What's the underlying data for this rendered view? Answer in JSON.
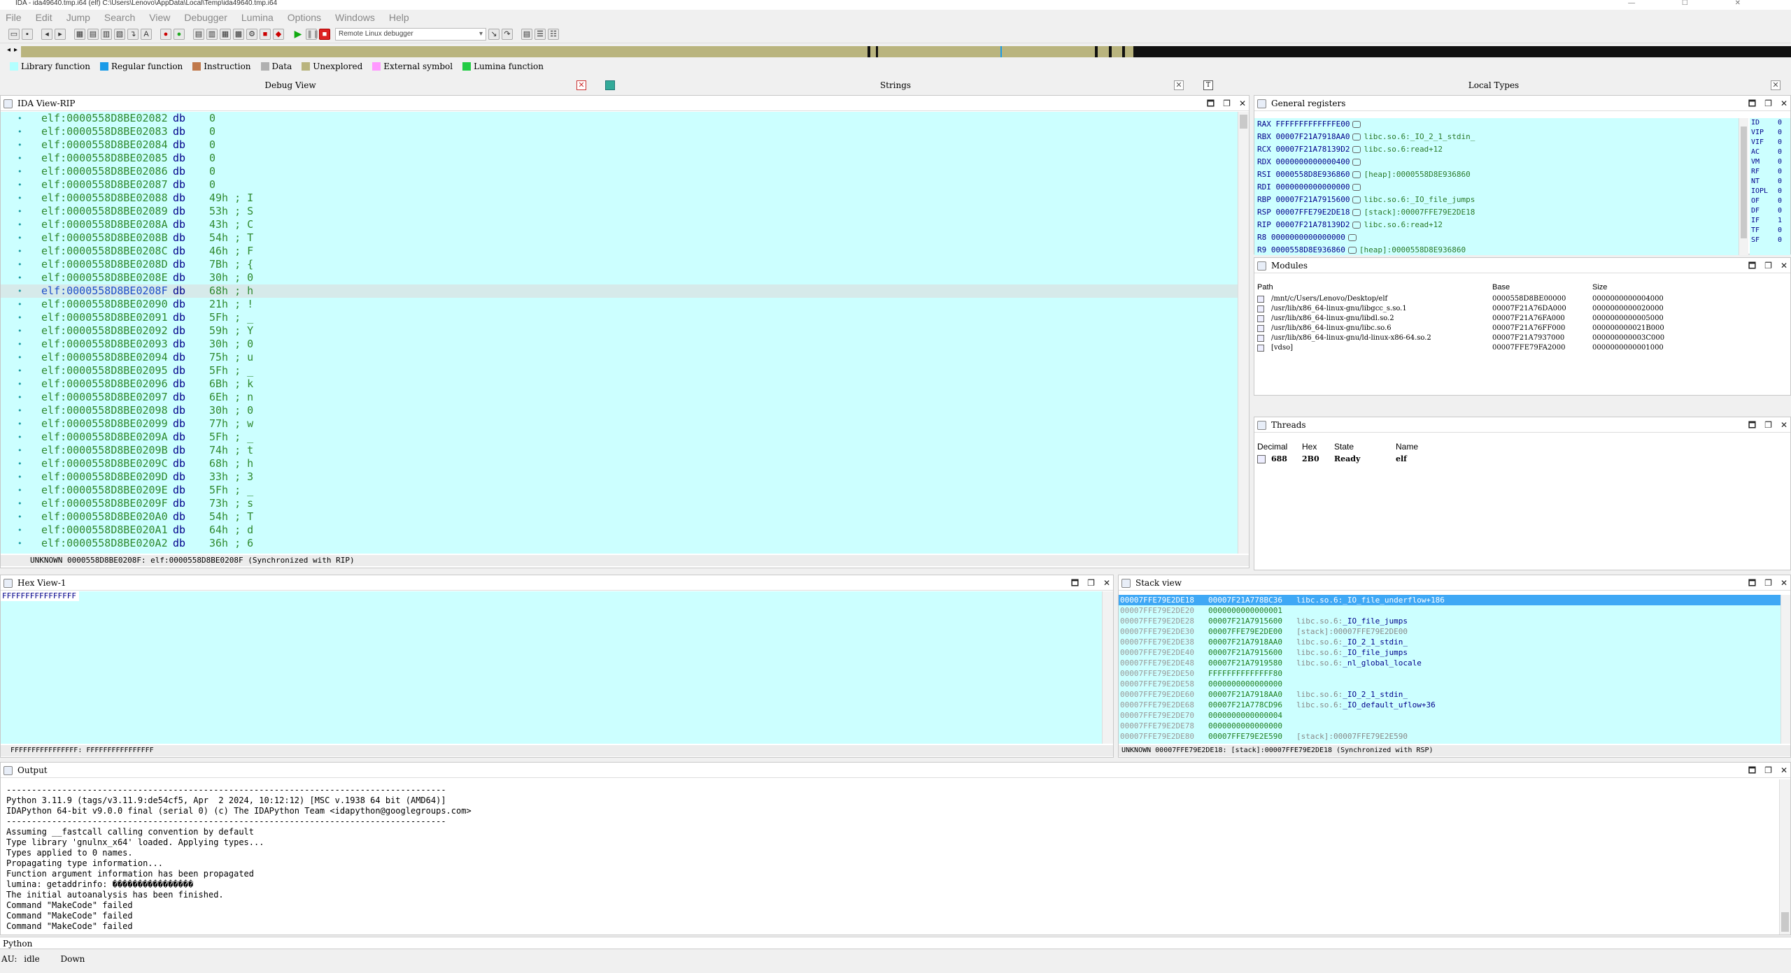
{
  "window": {
    "title": "IDA - ida49640.tmp.i64 (elf) C:\\Users\\Lenovo\\AppData\\Local\\Temp\\ida49640.tmp.i64"
  },
  "menu": [
    "File",
    "Edit",
    "Jump",
    "Search",
    "View",
    "Debugger",
    "Lumina",
    "Options",
    "Windows",
    "Help"
  ],
  "toolbar": {
    "debugger_select": "Remote Linux debugger"
  },
  "legend": [
    {
      "label": "Library function",
      "color": "#b3ffff"
    },
    {
      "label": "Regular function",
      "color": "#1a9be8"
    },
    {
      "label": "Instruction",
      "color": "#c0784a"
    },
    {
      "label": "Data",
      "color": "#b0b0b0"
    },
    {
      "label": "Unexplored",
      "color": "#b9b47e"
    },
    {
      "label": "External symbol",
      "color": "#ff99ff"
    },
    {
      "label": "Lumina function",
      "color": "#22cc44"
    }
  ],
  "top_tabs": {
    "debug_view": "Debug View",
    "strings": "Strings",
    "local_types": "Local Types"
  },
  "ida_view": {
    "title": "IDA View-RIP",
    "lines": [
      {
        "addr": "elf:0000558D8BE02082",
        "op": "db",
        "val": "0"
      },
      {
        "addr": "elf:0000558D8BE02083",
        "op": "db",
        "val": "0"
      },
      {
        "addr": "elf:0000558D8BE02084",
        "op": "db",
        "val": "0"
      },
      {
        "addr": "elf:0000558D8BE02085",
        "op": "db",
        "val": "0"
      },
      {
        "addr": "elf:0000558D8BE02086",
        "op": "db",
        "val": "0"
      },
      {
        "addr": "elf:0000558D8BE02087",
        "op": "db",
        "val": "0"
      },
      {
        "addr": "elf:0000558D8BE02088",
        "op": "db",
        "val": "49h ; I"
      },
      {
        "addr": "elf:0000558D8BE02089",
        "op": "db",
        "val": "53h ; S"
      },
      {
        "addr": "elf:0000558D8BE0208A",
        "op": "db",
        "val": "43h ; C"
      },
      {
        "addr": "elf:0000558D8BE0208B",
        "op": "db",
        "val": "54h ; T"
      },
      {
        "addr": "elf:0000558D8BE0208C",
        "op": "db",
        "val": "46h ; F"
      },
      {
        "addr": "elf:0000558D8BE0208D",
        "op": "db",
        "val": "7Bh ; {"
      },
      {
        "addr": "elf:0000558D8BE0208E",
        "op": "db",
        "val": "30h ; 0"
      },
      {
        "addr": "elf:0000558D8BE0208F",
        "op": "db",
        "val": "68h ; h"
      },
      {
        "addr": "elf:0000558D8BE02090",
        "op": "db",
        "val": "21h ; !"
      },
      {
        "addr": "elf:0000558D8BE02091",
        "op": "db",
        "val": "5Fh ; _"
      },
      {
        "addr": "elf:0000558D8BE02092",
        "op": "db",
        "val": "59h ; Y"
      },
      {
        "addr": "elf:0000558D8BE02093",
        "op": "db",
        "val": "30h ; 0"
      },
      {
        "addr": "elf:0000558D8BE02094",
        "op": "db",
        "val": "75h ; u"
      },
      {
        "addr": "elf:0000558D8BE02095",
        "op": "db",
        "val": "5Fh ; _"
      },
      {
        "addr": "elf:0000558D8BE02096",
        "op": "db",
        "val": "6Bh ; k"
      },
      {
        "addr": "elf:0000558D8BE02097",
        "op": "db",
        "val": "6Eh ; n"
      },
      {
        "addr": "elf:0000558D8BE02098",
        "op": "db",
        "val": "30h ; 0"
      },
      {
        "addr": "elf:0000558D8BE02099",
        "op": "db",
        "val": "77h ; w"
      },
      {
        "addr": "elf:0000558D8BE0209A",
        "op": "db",
        "val": "5Fh ; _"
      },
      {
        "addr": "elf:0000558D8BE0209B",
        "op": "db",
        "val": "74h ; t"
      },
      {
        "addr": "elf:0000558D8BE0209C",
        "op": "db",
        "val": "68h ; h"
      },
      {
        "addr": "elf:0000558D8BE0209D",
        "op": "db",
        "val": "33h ; 3"
      },
      {
        "addr": "elf:0000558D8BE0209E",
        "op": "db",
        "val": "5Fh ; _"
      },
      {
        "addr": "elf:0000558D8BE0209F",
        "op": "db",
        "val": "73h ; s"
      },
      {
        "addr": "elf:0000558D8BE020A0",
        "op": "db",
        "val": "54h ; T"
      },
      {
        "addr": "elf:0000558D8BE020A1",
        "op": "db",
        "val": "64h ; d"
      },
      {
        "addr": "elf:0000558D8BE020A2",
        "op": "db",
        "val": "36h ; 6"
      }
    ],
    "status": "UNKNOWN 0000558D8BE0208F: elf:0000558D8BE0208F (Synchronized with RIP)"
  },
  "registers": {
    "title": "General registers",
    "rows": [
      {
        "name": "RAX",
        "value": "FFFFFFFFFFFFFE00",
        "ref": ""
      },
      {
        "name": "RBX",
        "value": "00007F21A7918AA0",
        "ref": "libc.so.6:_IO_2_1_stdin_"
      },
      {
        "name": "RCX",
        "value": "00007F21A78139D2",
        "ref": "libc.so.6:read+12"
      },
      {
        "name": "RDX",
        "value": "0000000000000400",
        "ref": ""
      },
      {
        "name": "RSI",
        "value": "0000558D8E936860",
        "ref": "[heap]:0000558D8E936860"
      },
      {
        "name": "RDI",
        "value": "0000000000000000",
        "ref": ""
      },
      {
        "name": "RBP",
        "value": "00007F21A7915600",
        "ref": "libc.so.6:_IO_file_jumps"
      },
      {
        "name": "RSP",
        "value": "00007FFE79E2DE18",
        "ref": "[stack]:00007FFE79E2DE18"
      },
      {
        "name": "RIP",
        "value": "00007F21A78139D2",
        "ref": "libc.so.6:read+12"
      },
      {
        "name": "R8",
        "value": "0000000000000000",
        "ref": ""
      },
      {
        "name": "R9",
        "value": "0000558D8E936860",
        "ref": "[heap]:0000558D8E936860"
      }
    ],
    "flags": [
      {
        "name": "ID",
        "value": "0"
      },
      {
        "name": "VIP",
        "value": "0"
      },
      {
        "name": "VIF",
        "value": "0"
      },
      {
        "name": "AC",
        "value": "0"
      },
      {
        "name": "VM",
        "value": "0"
      },
      {
        "name": "RF",
        "value": "0"
      },
      {
        "name": "NT",
        "value": "0"
      },
      {
        "name": "IOPL",
        "value": "0"
      },
      {
        "name": "OF",
        "value": "0"
      },
      {
        "name": "DF",
        "value": "0"
      },
      {
        "name": "IF",
        "value": "1"
      },
      {
        "name": "TF",
        "value": "0"
      },
      {
        "name": "SF",
        "value": "0"
      }
    ]
  },
  "modules": {
    "title": "Modules",
    "headers": {
      "path": "Path",
      "base": "Base",
      "size": "Size"
    },
    "rows": [
      {
        "path": "/mnt/c/Users/Lenovo/Desktop/elf",
        "base": "0000558D8BE00000",
        "size": "0000000000004000"
      },
      {
        "path": "/usr/lib/x86_64-linux-gnu/libgcc_s.so.1",
        "base": "00007F21A76DA000",
        "size": "0000000000020000"
      },
      {
        "path": "/usr/lib/x86_64-linux-gnu/libdl.so.2",
        "base": "00007F21A76FA000",
        "size": "0000000000005000"
      },
      {
        "path": "/usr/lib/x86_64-linux-gnu/libc.so.6",
        "base": "00007F21A76FF000",
        "size": "000000000021B000"
      },
      {
        "path": "/usr/lib/x86_64-linux-gnu/ld-linux-x86-64.so.2",
        "base": "00007F21A7937000",
        "size": "000000000003C000"
      },
      {
        "path": "[vdso]",
        "base": "00007FFE79FA2000",
        "size": "0000000000001000"
      }
    ]
  },
  "threads": {
    "title": "Threads",
    "headers": {
      "decimal": "Decimal",
      "hex": "Hex",
      "state": "State",
      "name": "Name"
    },
    "rows": [
      {
        "decimal": "688",
        "hex": "2B0",
        "state": "Ready",
        "name": "elf"
      }
    ]
  },
  "hex_view": {
    "title": "Hex View-1",
    "content": "FFFFFFFFFFFFFFFF",
    "status": "FFFFFFFFFFFFFFFF: FFFFFFFFFFFFFFFF"
  },
  "stack_view": {
    "title": "Stack view",
    "rows": [
      {
        "addr": "00007FFE79E2DE18",
        "val": "00007F21A778BC36",
        "ref": "libc.so.6:",
        "refname": "_IO_file_underflow+186"
      },
      {
        "addr": "00007FFE79E2DE20",
        "val": "0000000000000001",
        "ref": "",
        "refname": ""
      },
      {
        "addr": "00007FFE79E2DE28",
        "val": "00007F21A7915600",
        "ref": "libc.so.6:",
        "refname": "_IO_file_jumps"
      },
      {
        "addr": "00007FFE79E2DE30",
        "val": "00007FFE79E2DE00",
        "ref": "[stack]:00007FFE79E2DE00",
        "refname": ""
      },
      {
        "addr": "00007FFE79E2DE38",
        "val": "00007F21A7918AA0",
        "ref": "libc.so.6:",
        "refname": "_IO_2_1_stdin_"
      },
      {
        "addr": "00007FFE79E2DE40",
        "val": "00007F21A7915600",
        "ref": "libc.so.6:",
        "refname": "_IO_file_jumps"
      },
      {
        "addr": "00007FFE79E2DE48",
        "val": "00007F21A7919580",
        "ref": "libc.so.6:",
        "refname": "_nl_global_locale"
      },
      {
        "addr": "00007FFE79E2DE50",
        "val": "FFFFFFFFFFFFFF80",
        "ref": "",
        "refname": ""
      },
      {
        "addr": "00007FFE79E2DE58",
        "val": "0000000000000000",
        "ref": "",
        "refname": ""
      },
      {
        "addr": "00007FFE79E2DE60",
        "val": "00007F21A7918AA0",
        "ref": "libc.so.6:",
        "refname": "_IO_2_1_stdin_"
      },
      {
        "addr": "00007FFE79E2DE68",
        "val": "00007F21A778CD96",
        "ref": "libc.so.6:",
        "refname": "_IO_default_uflow+36"
      },
      {
        "addr": "00007FFE79E2DE70",
        "val": "0000000000000004",
        "ref": "",
        "refname": ""
      },
      {
        "addr": "00007FFE79E2DE78",
        "val": "0000000000000000",
        "ref": "",
        "refname": ""
      },
      {
        "addr": "00007FFE79E2DE80",
        "val": "00007FFE79E2E590",
        "ref": "[stack]:00007FFE79E2E590",
        "refname": ""
      }
    ],
    "status": "UNKNOWN 00007FFE79E2DE18: [stack]:00007FFE79E2DE18 (Synchronized with RSP)"
  },
  "output": {
    "title": "Output",
    "lines": [
      "---------------------------------------------------------------------------------------",
      "Python 3.11.9 (tags/v3.11.9:de54cf5, Apr  2 2024, 10:12:12) [MSC v.1938 64 bit (AMD64)]",
      "IDAPython 64-bit v9.0.0 final (serial 0) (c) The IDAPython Team <idapython@googlegroups.com>",
      "---------------------------------------------------------------------------------------",
      "Assuming __fastcall calling convention by default",
      "Type library 'gnulnx_x64' loaded. Applying types...",
      "Types applied to 0 names.",
      "Propagating type information...",
      "Function argument information has been propagated",
      "lumina: getaddrinfo: ����������������",
      "The initial autoanalysis has been finished.",
      "Command \"MakeCode\" failed",
      "Command \"MakeCode\" failed",
      "Command \"MakeCode\" failed"
    ]
  },
  "python_bar": {
    "label": "Python"
  },
  "statusbar": {
    "au": "AU:",
    "state": "idle",
    "dir": "Down"
  }
}
